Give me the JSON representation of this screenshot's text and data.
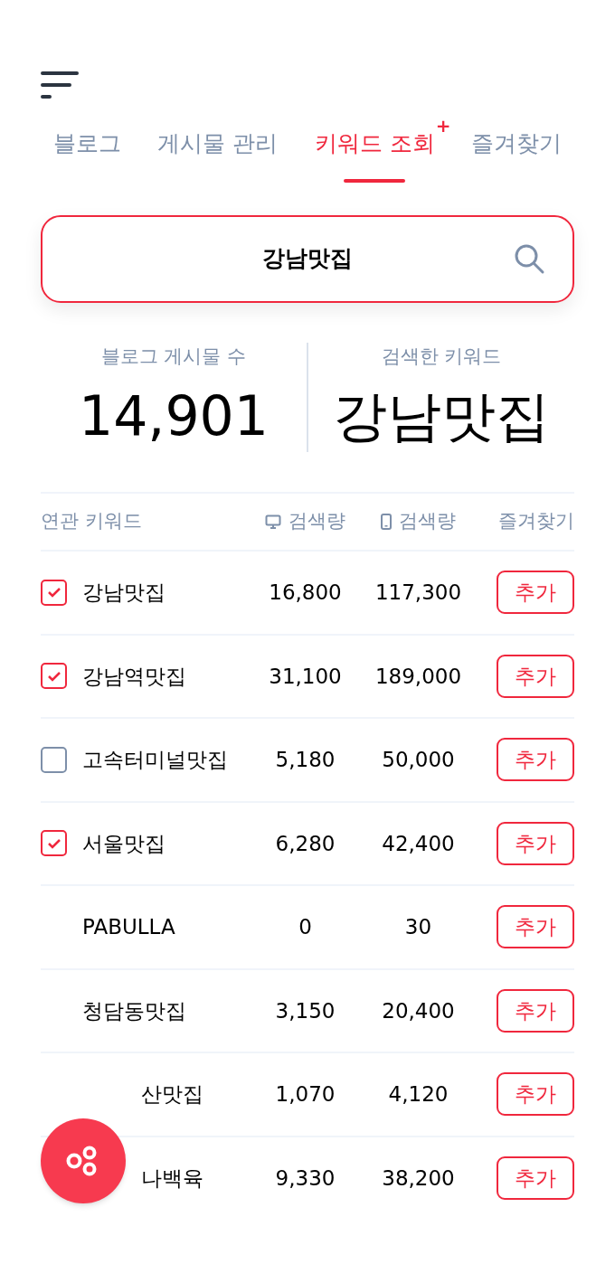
{
  "tabs": [
    {
      "label": "블로그",
      "selected": false
    },
    {
      "label": "게시물 관리",
      "selected": false
    },
    {
      "label": "키워드 조회",
      "selected": true,
      "badge": "+"
    },
    {
      "label": "즐겨찾기",
      "selected": false
    }
  ],
  "search": {
    "value": "강남맛집"
  },
  "stats": [
    {
      "label": "블로그 게시물 수",
      "value": "14,901"
    },
    {
      "label": "검색한 키워드",
      "value": "강남맛집"
    }
  ],
  "table": {
    "columns": [
      {
        "label": "연관 키워드",
        "kind": "text"
      },
      {
        "label": "검색량",
        "kind": "desktop"
      },
      {
        "label": "검색량",
        "kind": "mobile"
      },
      {
        "label": "즐겨찾기",
        "kind": "text"
      }
    ],
    "rows": [
      {
        "keyword": "강남맛집",
        "pc": "16,800",
        "mobile": "117,300",
        "action": "추가",
        "kind": "checkbox",
        "checked": true
      },
      {
        "keyword": "강남역맛집",
        "pc": "31,100",
        "mobile": "189,000",
        "action": "추가",
        "kind": "checkbox",
        "checked": true
      },
      {
        "keyword": "고속터미널맛집",
        "pc": "5,180",
        "mobile": "50,000",
        "action": "추가",
        "kind": "checkbox",
        "checked": false
      },
      {
        "keyword": "서울맛집",
        "pc": "6,280",
        "mobile": "42,400",
        "action": "추가",
        "kind": "checkbox",
        "checked": true
      },
      {
        "keyword": "PABULLA",
        "pc": "0",
        "mobile": "30",
        "action": "추가",
        "kind": "plain"
      },
      {
        "keyword": "청담동맛집",
        "pc": "3,150",
        "mobile": "20,400",
        "action": "추가",
        "kind": "plain"
      },
      {
        "keyword": "산맛집",
        "pc": "1,070",
        "mobile": "4,120",
        "action": "추가",
        "kind": "covered"
      },
      {
        "keyword": "나백육",
        "pc": "9,330",
        "mobile": "38,200",
        "action": "추가",
        "kind": "covered"
      }
    ]
  }
}
